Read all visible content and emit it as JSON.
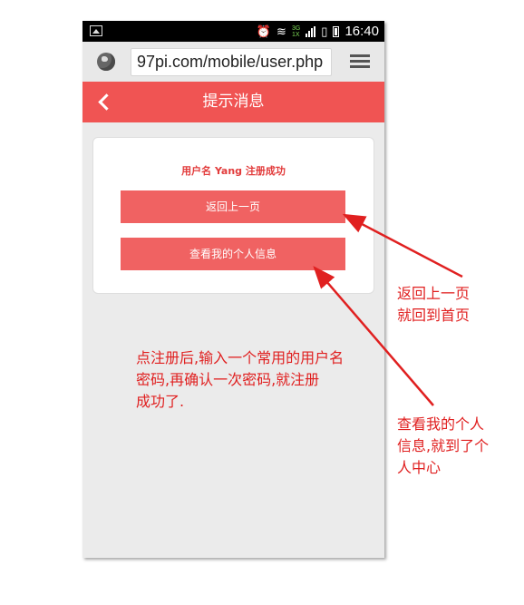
{
  "status_bar": {
    "time": "16:40",
    "network_top": "3G",
    "network_bottom": "1X"
  },
  "browser": {
    "url": "97pi.com/mobile/user.php"
  },
  "header": {
    "title": "提示消息"
  },
  "card": {
    "message": "用户名 Yang 注册成功",
    "back_button": "返回上一页",
    "profile_button": "查看我的个人信息"
  },
  "annotations": {
    "back_note": [
      "返回上一页",
      "就回到首页"
    ],
    "register_note": [
      "点注册后,输入一个常用的用户名",
      "密码,再确认一次密码,就注册",
      "成功了."
    ],
    "profile_note": [
      "查看我的个人",
      "信息,就到了个",
      "人中心"
    ]
  },
  "colors": {
    "accent": "#f05453",
    "button": "#f06262",
    "annotation": "#e02020"
  }
}
